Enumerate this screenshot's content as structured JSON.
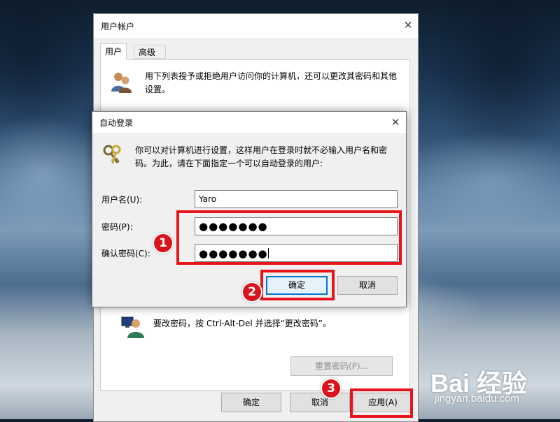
{
  "user_accounts_window": {
    "title": "用户帐户",
    "close_glyph": "✕",
    "tabs": [
      {
        "label": "用户",
        "active": true
      },
      {
        "label": "高级",
        "active": false
      }
    ],
    "description": "用下列表授予或拒绝用户访问你的计算机，还可以更改其密码和其他设置。",
    "password_hint": "要改密码，按 Ctrl-Alt-Del 并选择“更改密码”。",
    "reset_password_button": "重置密码(P)...",
    "ok_button": "确定",
    "cancel_button": "取消",
    "apply_button": "应用(A)"
  },
  "autologon_dialog": {
    "title": "自动登录",
    "close_glyph": "✕",
    "description": "你可以对计算机进行设置，这样用户在登录时就不必输入用户名和密码。为此，请在下面指定一个可以自动登录的用户:",
    "username_label": "用户名(U):",
    "username_value": "Yaro",
    "password_label": "密码(P):",
    "password_value": "●●●●●●●",
    "confirm_label": "确认密码(C):",
    "confirm_value": "●●●●●●●",
    "ok_button": "确定",
    "cancel_button": "取消"
  },
  "annotations": {
    "step1": "1",
    "step2": "2",
    "step3": "3",
    "highlight_color": "#e8141b"
  },
  "watermark": {
    "logo": "Bai 经验",
    "url": "jingyan.baidu.com"
  },
  "icons": [
    "users-icon",
    "keys-icon",
    "user-monitor-icon",
    "close-icon"
  ]
}
